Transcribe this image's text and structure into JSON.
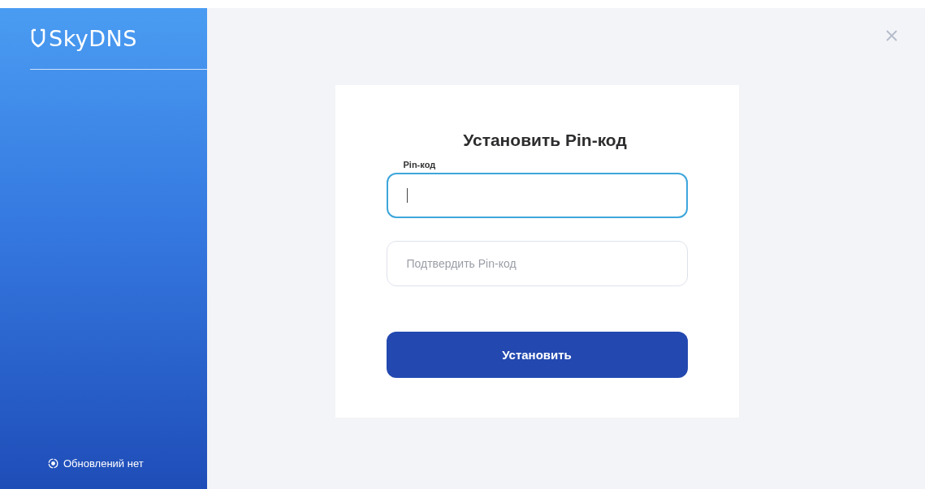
{
  "sidebar": {
    "logo": "SkyDNS",
    "status": "Обновлений нет"
  },
  "dialog": {
    "title": "Установить Pin-код",
    "fields": [
      {
        "label": "Pin-код",
        "focused": true
      },
      {
        "placeholder": "Подтвердить Pin-код",
        "focused": false
      }
    ],
    "button": "Установить"
  }
}
